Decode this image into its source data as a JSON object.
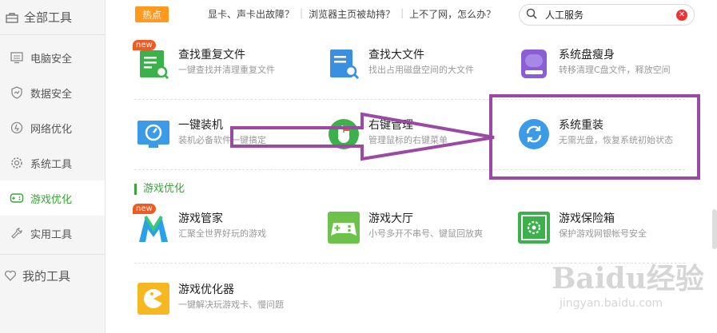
{
  "sidebar": {
    "all_tools": "全部工具",
    "items": [
      {
        "label": "电脑安全",
        "icon": "monitor-icon"
      },
      {
        "label": "数据安全",
        "icon": "shield-icon"
      },
      {
        "label": "网络优化",
        "icon": "network-icon"
      },
      {
        "label": "系统工具",
        "icon": "gear-icon"
      },
      {
        "label": "游戏优化",
        "icon": "gamepad-icon",
        "active": true
      },
      {
        "label": "实用工具",
        "icon": "wrench-icon"
      }
    ],
    "my_tools": "我的工具"
  },
  "topbar": {
    "hot_label": "热点",
    "links": [
      "显卡、声卡出故障？",
      "浏览器主页被劫持？",
      "上不了网，怎么办？"
    ],
    "search_value": "人工服务"
  },
  "tools": {
    "dup_files": {
      "name": "查找重复文件",
      "desc": "一键查找并清理重复文件",
      "badge": "new",
      "color": "#3cb04a"
    },
    "big_files": {
      "name": "查找大文件",
      "desc": "找出占用磁盘空间的大文件",
      "color": "#3b8fe0"
    },
    "disk_slim": {
      "name": "系统盘瘦身",
      "desc": "转移清理C盘文件，释放空间",
      "color": "#8a5fd6"
    },
    "one_click_install": {
      "name": "一键装机",
      "desc": "装机必备软件一键搞定",
      "color": "#3b9be6"
    },
    "right_click": {
      "name": "右键管理",
      "desc": "管理鼠标的右键菜单",
      "color": "#3cb04a"
    },
    "reinstall": {
      "name": "系统重装",
      "desc": "无需光盘，恢复系统初始状态",
      "color": "#3b9be6"
    },
    "game_manager": {
      "name": "游戏管家",
      "desc": "汇聚全世界好玩的游戏",
      "badge": "new",
      "color": "#2aa0e8"
    },
    "game_hall": {
      "name": "游戏大厅",
      "desc": "小号多开不串号、键鼠回放爽",
      "color": "#6cc24a"
    },
    "game_safe": {
      "name": "游戏保险箱",
      "desc": "保护游戏网银帐号安全",
      "color": "#3cb04a"
    },
    "game_optimizer": {
      "name": "游戏优化器",
      "desc": "一键解决玩游戏卡、慢问题",
      "color": "#f5b820"
    }
  },
  "section_game": "游戏优化",
  "watermark": {
    "main": "Baidu经验",
    "sub": "jingyan.baidu.com"
  },
  "annotation_color": "#9b4aa3"
}
